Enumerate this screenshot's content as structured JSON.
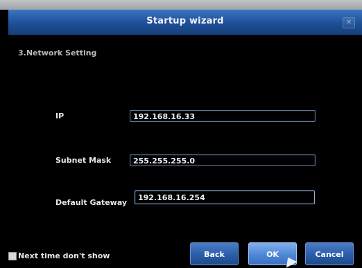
{
  "window": {
    "title": "Startup wizard",
    "close_icon": "close-icon"
  },
  "step": {
    "title": "3.Network Setting"
  },
  "fields": {
    "ip": {
      "label": "IP",
      "value": "192.168.16.33"
    },
    "subnet": {
      "label": "Subnet Mask",
      "value": "255.255.255.0"
    },
    "gateway": {
      "label": "Default Gateway",
      "value": "192.168.16.254"
    }
  },
  "footer": {
    "checkbox_label": "Next time don't show",
    "back_label": "Back",
    "ok_label": "OK",
    "cancel_label": "Cancel"
  },
  "colors": {
    "title_bar": "#2a5da8",
    "button": "#2b5da8",
    "button_focus": "#4f86d6",
    "background": "#000000"
  }
}
